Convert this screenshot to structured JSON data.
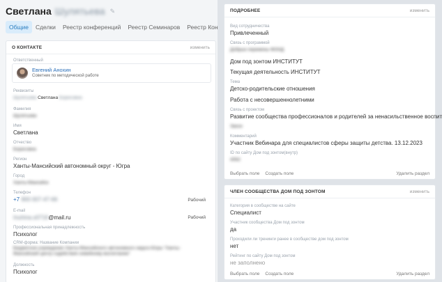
{
  "header": {
    "first_name": "Светлана",
    "last_name_blurred": "Шулятьева",
    "edit_icon": "pencil-icon"
  },
  "tabs": [
    "Общие",
    "Сделки",
    "Реестр конференций",
    "Реестр Семинаров",
    "Реестр Консультаций"
  ],
  "contact": {
    "title": "О КОНТАКТЕ",
    "edit": "изменить",
    "responsible_label": "Ответственный",
    "responsible_name": "Евгений Анохин",
    "responsible_role": "Советник по методической работе",
    "requisites_label": "Реквизиты",
    "requisites_pre": "Шулятьева",
    "requisites_mid": "Светлана",
    "requisites_post": "Борисовна",
    "surname_label": "Фамилия",
    "surname_value": "Шулятьева",
    "name_label": "Имя",
    "name_value": "Светлана",
    "patronymic_label": "Отчество",
    "patronymic_value": "Борисовна",
    "region_label": "Регион",
    "region_value": "Ханты-Мансийский автономный округ - Югра",
    "city_label": "Город",
    "city_value": "Ханты-Мансийск",
    "phone_label": "Телефон",
    "phone_prefix": "+7",
    "phone_blurred": "900 007-47-66",
    "phone_type": "Рабочий",
    "email_label": "E-mail",
    "email_blurred": "Inuhina.s0716",
    "email_domain": "@mail.ru",
    "email_type": "Рабочий",
    "prof_label": "Профессиональная принадлежность",
    "prof_value": "Психолог",
    "crm_label": "CRM-форма: Название Компании",
    "crm_value_1": "Бюджетное учреждение Ханты-Мансийского автономного округа Югры \"Ханты-",
    "crm_value_2": "Мансийский центр содействия семейному воспитанию\"",
    "position_label": "Должность",
    "position_value": "Психолог"
  },
  "details": {
    "title": "ПОДРОБНЕЕ",
    "edit": "изменить",
    "employee_type_label": "Вид сотрудничества",
    "employee_type_value": "Привлеченный",
    "program_label": "Связь с программой",
    "program_value_blurred": "Добрые перемены ФОНД",
    "program_value_2": "Дом под зонтом ИНСТИТУТ",
    "program_value_3": "Текущая деятельность ИНСТИТУТ",
    "topic_label": "Тема",
    "topic_value_1": "Детско-родительские отношения",
    "topic_value_2": "Работа с несовершеннолетними",
    "project_label": "Связь с проектом",
    "project_value_1": "Развитие сообщества профессионалов и родителей за ненасильственное воспитание",
    "project_value_blurred": "Закон",
    "comment_label": "Комментарий",
    "comment_value": "Участник Вебинара для специалистов сферы защиты детства. 13.12.2023",
    "site_id_label": "ID по сайту Дом под зонтом(внутр)",
    "site_id_value_blurred": "4063",
    "choose_field": "Выбрать поле",
    "create_field": "Создать поле",
    "delete_section": "Удалить раздел"
  },
  "member": {
    "title": "ЧЛЕН СООБЩЕСТВА ДОМ ПОД ЗОНТОМ",
    "edit": "изменить",
    "category_label": "Категория в сообществе на сайте",
    "category_value": "Специалист",
    "participant_label": "Участник сообщества Дом под зонтом",
    "participant_value": "да",
    "training_label": "Проходили ли тренинги ранее в сообществе дом под зонтом",
    "training_value": "нет",
    "rating_label": "Рейтинг по сайту Дом под зонтом",
    "rating_value": "не заполнено",
    "choose_field": "Выбрать поле",
    "create_field": "Создать поле",
    "delete_section": "Удалить раздел"
  }
}
